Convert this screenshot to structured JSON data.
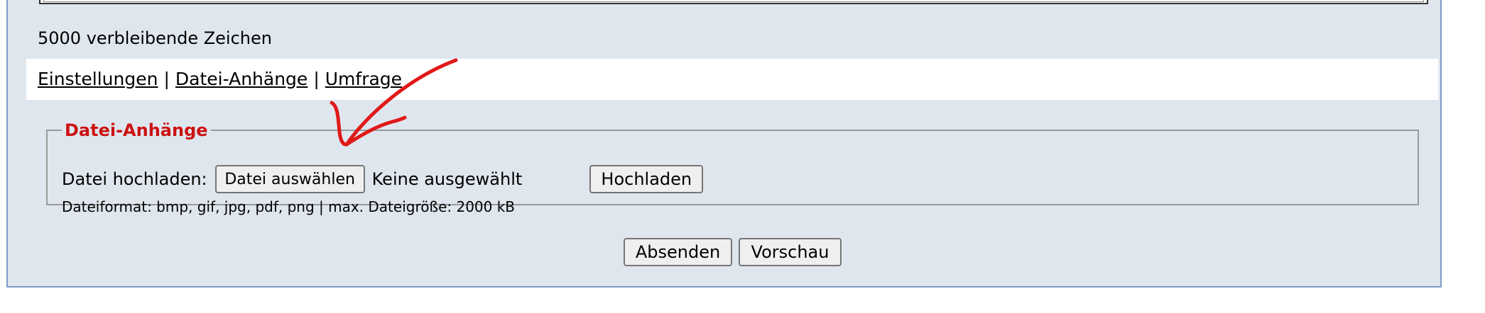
{
  "remaining_chars": "5000 verbleibende Zeichen",
  "tabs": [
    {
      "label": "Einstellungen"
    },
    {
      "label": "Datei-Anhänge"
    },
    {
      "label": "Umfrage"
    }
  ],
  "tab_separator": "|",
  "attachments": {
    "legend": "Datei-Anhänge",
    "upload_label": "Datei hochladen:",
    "choose_file_button": "Datei auswählen",
    "no_file_text": "Keine ausgewählt",
    "upload_button": "Hochladen",
    "hint": "Dateiformat: bmp, gif, jpg, pdf, png | max. Dateigröße: 2000 kB"
  },
  "buttons": {
    "submit": "Absenden",
    "preview": "Vorschau"
  },
  "colors": {
    "panel_bg": "#dfe6ee",
    "legend_red": "#cc1111",
    "annotation_red": "#e01818"
  }
}
